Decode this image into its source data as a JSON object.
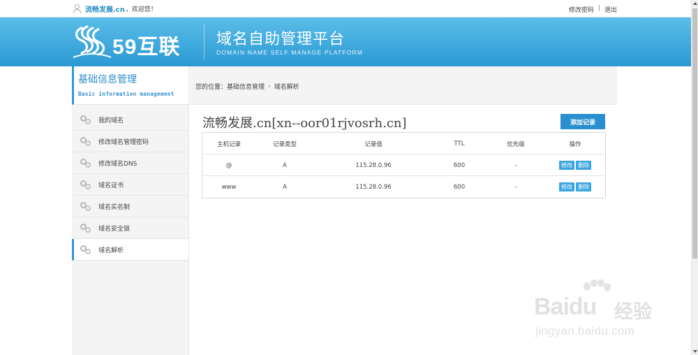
{
  "topbar": {
    "username": "流畅发展.cn",
    "welcome": "，欢迎您！",
    "change_password": "修改密码",
    "separator": "|",
    "logout": "退出"
  },
  "header": {
    "logo_text": "59互联",
    "platform_title": "域名自助管理平台",
    "platform_subtitle": "DOMAIN NAME SELF MANAGE PLATFORM"
  },
  "sidebar": {
    "title": "基础信息管理",
    "subtitle": "Basic information management",
    "items": [
      {
        "label": "我的域名"
      },
      {
        "label": "修改域名管理密码"
      },
      {
        "label": "修改域名DNS"
      },
      {
        "label": "域名证书"
      },
      {
        "label": "域名实名制"
      },
      {
        "label": "域名安全锁"
      },
      {
        "label": "域名解析"
      }
    ]
  },
  "breadcrumb": {
    "prefix": "您的位置：",
    "level1": "基础信息管理",
    "level2": "域名解析"
  },
  "main": {
    "domain_title": "流畅发展.cn[xn--oor01rjvosrh.cn]",
    "add_record_button": "添加记录",
    "table": {
      "headers": [
        "主机记录",
        "记录类型",
        "记录值",
        "TTL",
        "优先级",
        "操作"
      ],
      "rows": [
        {
          "host": "@",
          "type": "A",
          "value": "115.28.0.96",
          "ttl": "600",
          "priority": "-",
          "edit": "修改",
          "delete": "删除"
        },
        {
          "host": "www",
          "type": "A",
          "value": "115.28.0.96",
          "ttl": "600",
          "priority": "-",
          "edit": "修改",
          "delete": "删除"
        }
      ]
    }
  },
  "watermark": {
    "brand": "Baidu",
    "brand_cn": "经验",
    "url": "jingyan.baidu.com"
  },
  "colors": {
    "accent": "#2a8fd0",
    "header_top": "#5bbde8",
    "header_bottom": "#2b99d4"
  }
}
